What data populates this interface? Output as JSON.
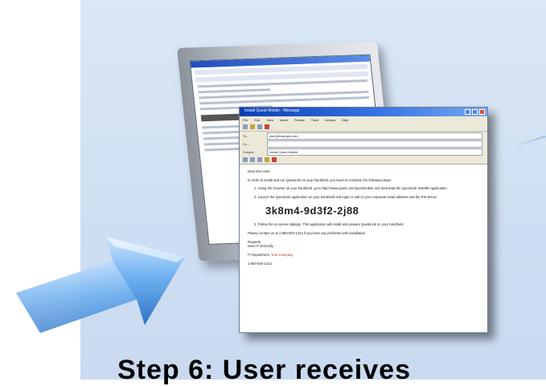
{
  "slide": {
    "caption": "Step 6: User receives"
  },
  "email_window": {
    "title": "Install Quest Mobile - Message",
    "menu": [
      "File",
      "Edit",
      "View",
      "Insert",
      "Format",
      "Tools",
      "Actions",
      "Help"
    ],
    "fields": [
      {
        "label": "To...",
        "value": "user@example.com"
      },
      {
        "label": "Cc...",
        "value": ""
      },
      {
        "label": "Subject:",
        "value": "Install Quest Mobile"
      }
    ],
    "greeting": "Dear End User,",
    "intro": "In order to install and run QuestLink on your handheld, you need to complete the following steps:",
    "step1": "Using the browser on your handheld, go to http://www.quest.com/questmobile and download the QuestLink Installer application.",
    "step2": "Launch the QuestLink application on your handheld and login or add to your corporate email address and the PIN below:",
    "activation_code": "3k8m4-9d3f2-2j88",
    "step3": "Follow the on-screen dialogs. This application will install and prepare QuestLink on your handheld.",
    "contact": "Please contact us at 1-800-000-1313 if you have any problems with installation.",
    "regards": "Regards,",
    "signature_name": "Sean P. Donnelly",
    "dept_label": "IT Department,",
    "company": "Your Company",
    "phone": "1-800-000-1313"
  },
  "colors": {
    "background_panel": "#d4e2f3",
    "arrow": "#4f9ae6",
    "titlebar": "#0a3fb4"
  }
}
